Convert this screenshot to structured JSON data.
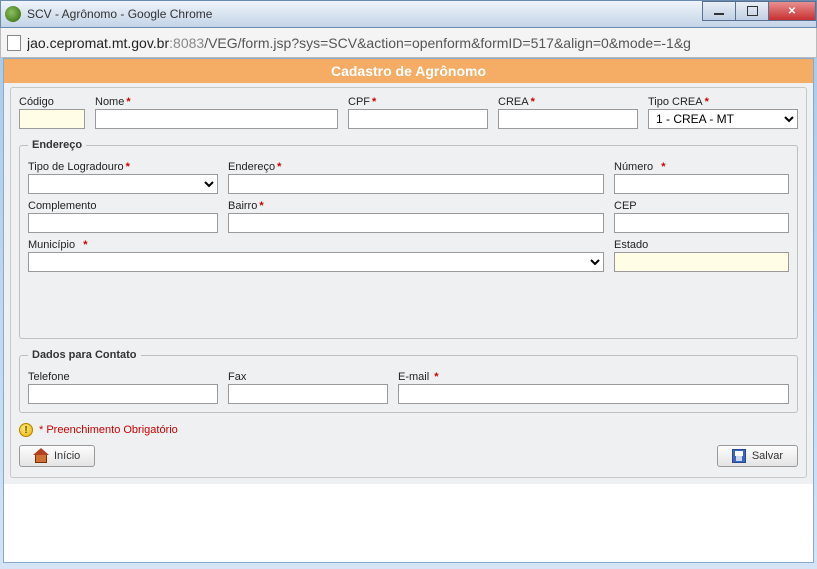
{
  "window": {
    "title": "SCV - Agrônomo - Google Chrome"
  },
  "url": {
    "host": "jao.cepromat.mt.gov.br",
    "port": ":8083",
    "path": "/VEG/form.jsp?sys=SCV&action=openform&formID=517&align=0&mode=-1&g"
  },
  "page": {
    "title": "Cadastro de Agrônomo"
  },
  "fields": {
    "codigo_label": "Código",
    "nome_label": "Nome",
    "cpf_label": "CPF",
    "crea_label": "CREA",
    "tipocrea_label": "Tipo CREA",
    "tipocrea_value": "1 - CREA - MT"
  },
  "endereco": {
    "legend": "Endereço",
    "tipo_logradouro_label": "Tipo de Logradouro",
    "endereco_label": "Endereço",
    "numero_label": "Número",
    "complemento_label": "Complemento",
    "bairro_label": "Bairro",
    "cep_label": "CEP",
    "municipio_label": "Município",
    "estado_label": "Estado"
  },
  "contato": {
    "legend": "Dados para Contato",
    "telefone_label": "Telefone",
    "fax_label": "Fax",
    "email_label": "E-mail"
  },
  "footnote": "* Preenchimento Obrigatório",
  "buttons": {
    "inicio": "Início",
    "salvar": "Salvar"
  }
}
